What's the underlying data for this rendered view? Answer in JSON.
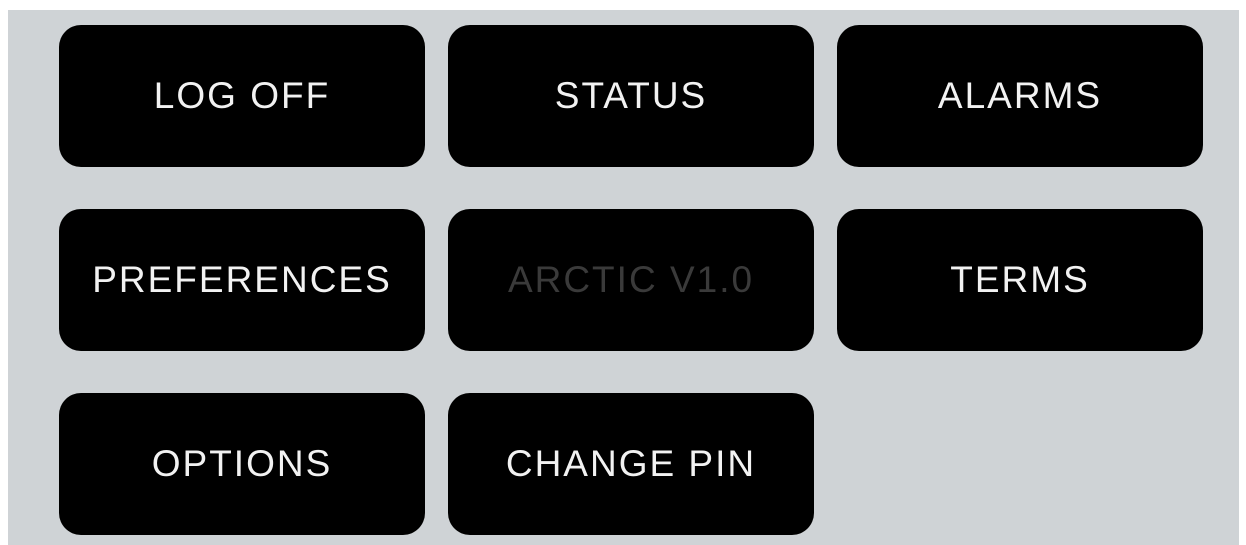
{
  "menu": {
    "buttons": [
      {
        "label": "LOG OFF",
        "enabled": true
      },
      {
        "label": "STATUS",
        "enabled": true
      },
      {
        "label": "ALARMS",
        "enabled": true
      },
      {
        "label": "PREFERENCES",
        "enabled": true
      },
      {
        "label": "ARCTIC V1.0",
        "enabled": false
      },
      {
        "label": "TERMS",
        "enabled": true
      },
      {
        "label": "OPTIONS",
        "enabled": true
      },
      {
        "label": "CHANGE PIN",
        "enabled": true
      }
    ]
  },
  "colors": {
    "background": "#cfd3d6",
    "button": "#000000",
    "text": "#f2f2f2",
    "disabled_text": "#3a3a3a"
  }
}
